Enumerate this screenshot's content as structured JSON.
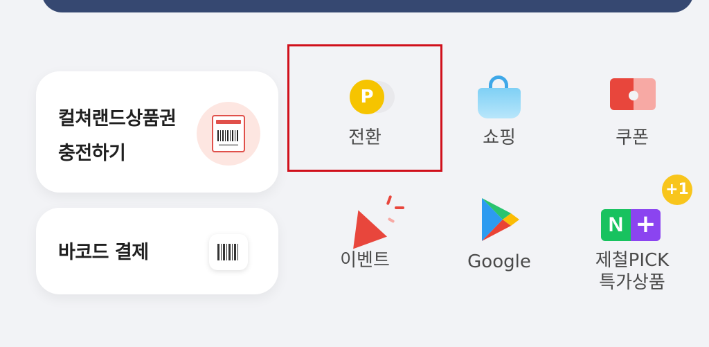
{
  "left_cards": {
    "gift": {
      "line1": "컬쳐랜드상품권",
      "line2": "충전하기",
      "icon": "gift-ticket-icon"
    },
    "barcode": {
      "label": "바코드 결제",
      "icon": "barcode-icon"
    }
  },
  "grid": [
    {
      "label": "전환",
      "icon": "point-coin-icon"
    },
    {
      "label": "쇼핑",
      "icon": "shopping-bag-icon"
    },
    {
      "label": "쿠폰",
      "icon": "coupon-icon"
    },
    {
      "label": "이벤트",
      "icon": "party-popper-icon"
    },
    {
      "label": "Google",
      "icon": "google-play-icon"
    },
    {
      "label": "제철PICK\n특가상품",
      "line1": "제철PICK",
      "line2": "특가상품",
      "icon": "naver-plus-icon",
      "badge": "+1"
    }
  ],
  "icon_text": {
    "point": "P",
    "naver_n": "N",
    "naver_plus": "+"
  },
  "colors": {
    "banner": "#364871",
    "highlight": "#d0101b",
    "coin": "#f6c400"
  }
}
